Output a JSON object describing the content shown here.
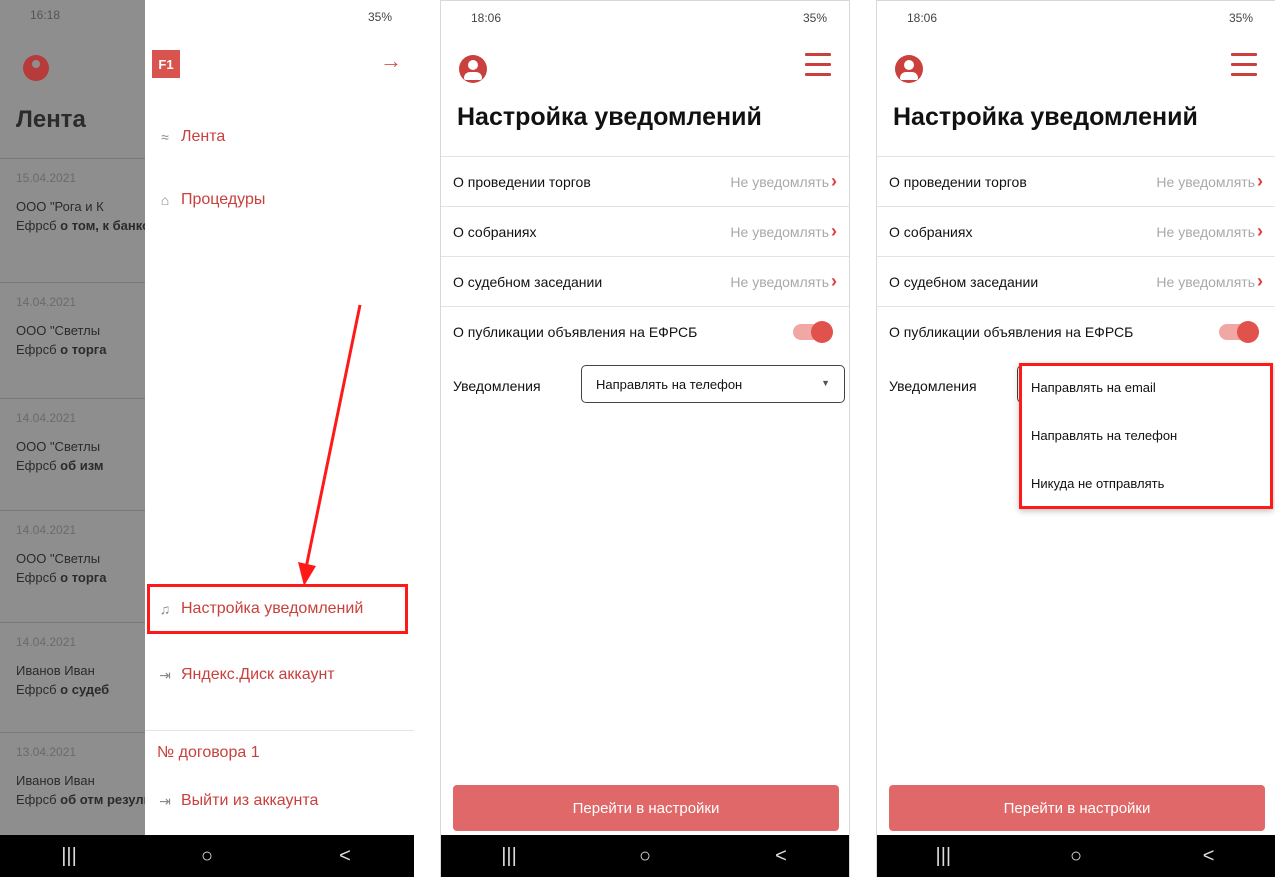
{
  "colors": {
    "accent": "#c9403c",
    "button": "#e06868",
    "highlight": "#ff1a1a"
  },
  "phone1": {
    "status_time": "16:18",
    "status_signal": "35%",
    "feed": {
      "title": "Лента",
      "items": [
        {
          "date": "15.04.2021",
          "org": "ООО \"Рога и К",
          "text_prefix": "Ефрсб",
          "text_bold": "о том, к банковский сч"
        },
        {
          "date": "14.04.2021",
          "org": "ООО \"Светлы",
          "text_prefix": "Ефрсб",
          "text_bold": "о торга"
        },
        {
          "date": "14.04.2021",
          "org": "ООО \"Светлы",
          "text_prefix": "Ефрсб",
          "text_bold": "об изм"
        },
        {
          "date": "14.04.2021",
          "org": "ООО \"Светлы",
          "text_prefix": "Ефрсб",
          "text_bold": "о торга"
        },
        {
          "date": "14.04.2021",
          "org": "Иванов Иван",
          "text_prefix": "Ефрсб",
          "text_bold": "о судеб"
        },
        {
          "date": "13.04.2021",
          "org": "Иванов Иван",
          "text_prefix": "Ефрсб",
          "text_bold": "об отм результатах"
        }
      ]
    },
    "drawer": {
      "logo": "F1",
      "items": [
        {
          "label": "Лента",
          "icon": "rss-icon"
        },
        {
          "label": "Процедуры",
          "icon": "bank-icon"
        },
        {
          "label": "Настройка уведомлений",
          "icon": "bell-icon"
        },
        {
          "label": "Яндекс.Диск аккаунт",
          "icon": "login-icon"
        }
      ],
      "contract": "№ договора 1",
      "logout": "Выйти из аккаунта"
    }
  },
  "settings": {
    "status_time": "18:06",
    "status_signal": "35%",
    "title": "Настройка уведомлений",
    "rows": [
      {
        "label": "О проведении торгов",
        "value": "Не уведомлять"
      },
      {
        "label": "О собраниях",
        "value": "Не уведомлять"
      },
      {
        "label": "О судебном заседании",
        "value": "Не уведомлять"
      }
    ],
    "toggle_label": "О публикации объявления на ЕФРСБ",
    "toggle_on": true,
    "notif_label": "Уведомления",
    "notif_selected": "Направлять на телефон",
    "notif_options": [
      "Направлять на email",
      "Направлять на телефон",
      "Никуда не отправлять"
    ],
    "button": "Перейти в настройки"
  },
  "navbar": {
    "recent": "|||",
    "home": "○",
    "back": "<"
  }
}
